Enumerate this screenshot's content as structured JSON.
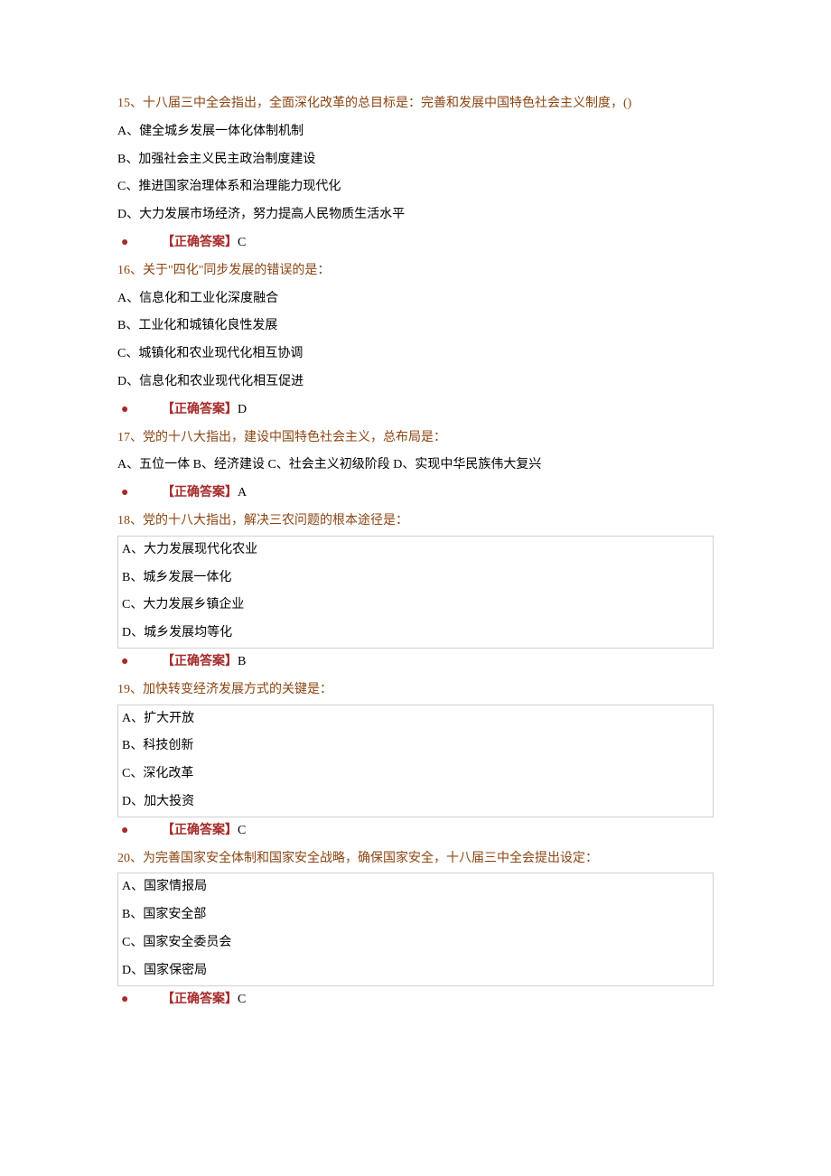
{
  "questions": [
    {
      "q_text": "15、十八届三中全会指出，全面深化改革的总目标是：完善和发展中国特色社会主义制度，()",
      "options": [
        "A、健全城乡发展一体化体制机制",
        "B、加强社会主义民主政治制度建设",
        "C、推进国家治理体系和治理能力现代化",
        "D、大力发展市场经济，努力提高人民物质生活水平"
      ],
      "boxed": false,
      "bullet": "●",
      "answer_label": "【正确答案】",
      "answer_value": "C"
    },
    {
      "q_text": "16、关于\"四化\"同步发展的错误的是：",
      "options": [
        "A、信息化和工业化深度融合",
        "B、工业化和城镇化良性发展",
        "C、城镇化和农业现代化相互协调",
        "D、信息化和农业现代化相互促进"
      ],
      "boxed": false,
      "bullet": "●",
      "answer_label": "【正确答案】",
      "answer_value": "D"
    },
    {
      "q_text": "17、党的十八大指出，建设中国特色社会主义，总布局是：",
      "options": [
        "A、五位一体 B、经济建设 C、社会主义初级阶段 D、实现中华民族伟大复兴"
      ],
      "boxed": false,
      "bullet": "●",
      "answer_label": "【正确答案】",
      "answer_value": "A"
    },
    {
      "q_text": "18、党的十八大指出，解决三农问题的根本途径是：",
      "options": [
        "A、大力发展现代化农业",
        "B、城乡发展一体化",
        "C、大力发展乡镇企业",
        "D、城乡发展均等化"
      ],
      "boxed": true,
      "bullet": "●",
      "answer_label": "【正确答案】",
      "answer_value": "B"
    },
    {
      "q_text": "19、加快转变经济发展方式的关键是：",
      "options": [
        "A、扩大开放",
        "B、科技创新",
        "C、深化改革",
        "D、加大投资"
      ],
      "boxed": true,
      "bullet": "●",
      "answer_label": "【正确答案】",
      "answer_value": "C"
    },
    {
      "q_text": "20、为完善国家安全体制和国家安全战略，确保国家安全，十八届三中全会提出设定：",
      "options": [
        "A、国家情报局",
        "B、国家安全部",
        "C、国家安全委员会",
        "D、国家保密局"
      ],
      "boxed": true,
      "bullet": "●",
      "answer_label": "【正确答案】",
      "answer_value": "C"
    }
  ]
}
